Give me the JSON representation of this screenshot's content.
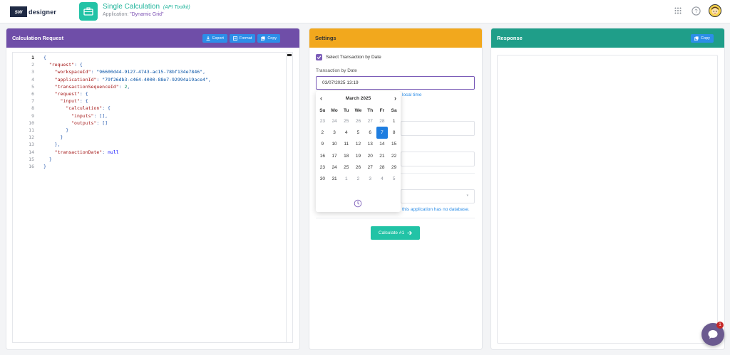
{
  "header": {
    "logo_box": "sw",
    "logo_text": "designer",
    "title": "Single Calculation",
    "title_tag": "(API Toolkit)",
    "sub_prefix": "Application: ",
    "sub_value": "\"Dynamic Grid\"",
    "icons": [
      "grid-apps-icon",
      "help-icon",
      "user-avatar"
    ]
  },
  "left_panel": {
    "title": "Calculation Request",
    "export_label": "Export",
    "format_label": "Format",
    "copy_label": "Copy",
    "line_numbers": [
      "1",
      "2",
      "3",
      "4",
      "5",
      "6",
      "7",
      "8",
      "9",
      "10",
      "11",
      "12",
      "13",
      "14",
      "15",
      "16"
    ],
    "json": {
      "l3_key": "\"workspaceId\"",
      "l3_val": "\"96600d44-9127-4743-ac15-78bf134e7846\"",
      "l4_key": "\"applicationId\"",
      "l4_val": "\"79f26db3-c464-4000-88e7-92994a19ace4\"",
      "l5_key": "\"transactionSequenceId\"",
      "l5_val": "2",
      "l2_key": "\"request\"",
      "l6_key": "\"request\"",
      "l7_key": "\"input\"",
      "l8_key": "\"calculation\"",
      "l9_key": "\"inputs\"",
      "l10_key": "\"outputs\"",
      "l14_key": "\"transactionDate\"",
      "l14_val": "null"
    }
  },
  "middle_panel": {
    "title": "Settings",
    "checkbox_label": "Select Transaction by Date",
    "checkbox_checked": true,
    "field_label": "Transaction by Date",
    "date_value": "03/07/2025 13:19",
    "local_time_hint": "local time",
    "no_db_hint": "this application has no database.",
    "calculate_label": "Calculate #1",
    "calendar": {
      "month_label": "March 2025",
      "weekdays": [
        "Su",
        "Mo",
        "Tu",
        "We",
        "Th",
        "Fr",
        "Sa"
      ],
      "weeks": [
        [
          "23",
          "24",
          "25",
          "26",
          "27",
          "28",
          "1"
        ],
        [
          "2",
          "3",
          "4",
          "5",
          "6",
          "7",
          "8"
        ],
        [
          "9",
          "10",
          "11",
          "12",
          "13",
          "14",
          "15"
        ],
        [
          "16",
          "17",
          "18",
          "19",
          "20",
          "21",
          "22"
        ],
        [
          "23",
          "24",
          "25",
          "26",
          "27",
          "28",
          "29"
        ],
        [
          "30",
          "31",
          "1",
          "2",
          "3",
          "4",
          "5"
        ]
      ],
      "selected": "7"
    }
  },
  "right_panel": {
    "title": "Response",
    "copy_label": "Copy"
  },
  "chat": {
    "badge": "1"
  },
  "colors": {
    "purple": "#6f4ea8",
    "orange": "#f2a81d",
    "teal": "#1f9e89",
    "accent_teal": "#22c3a6",
    "blue": "#2c8ee8"
  }
}
